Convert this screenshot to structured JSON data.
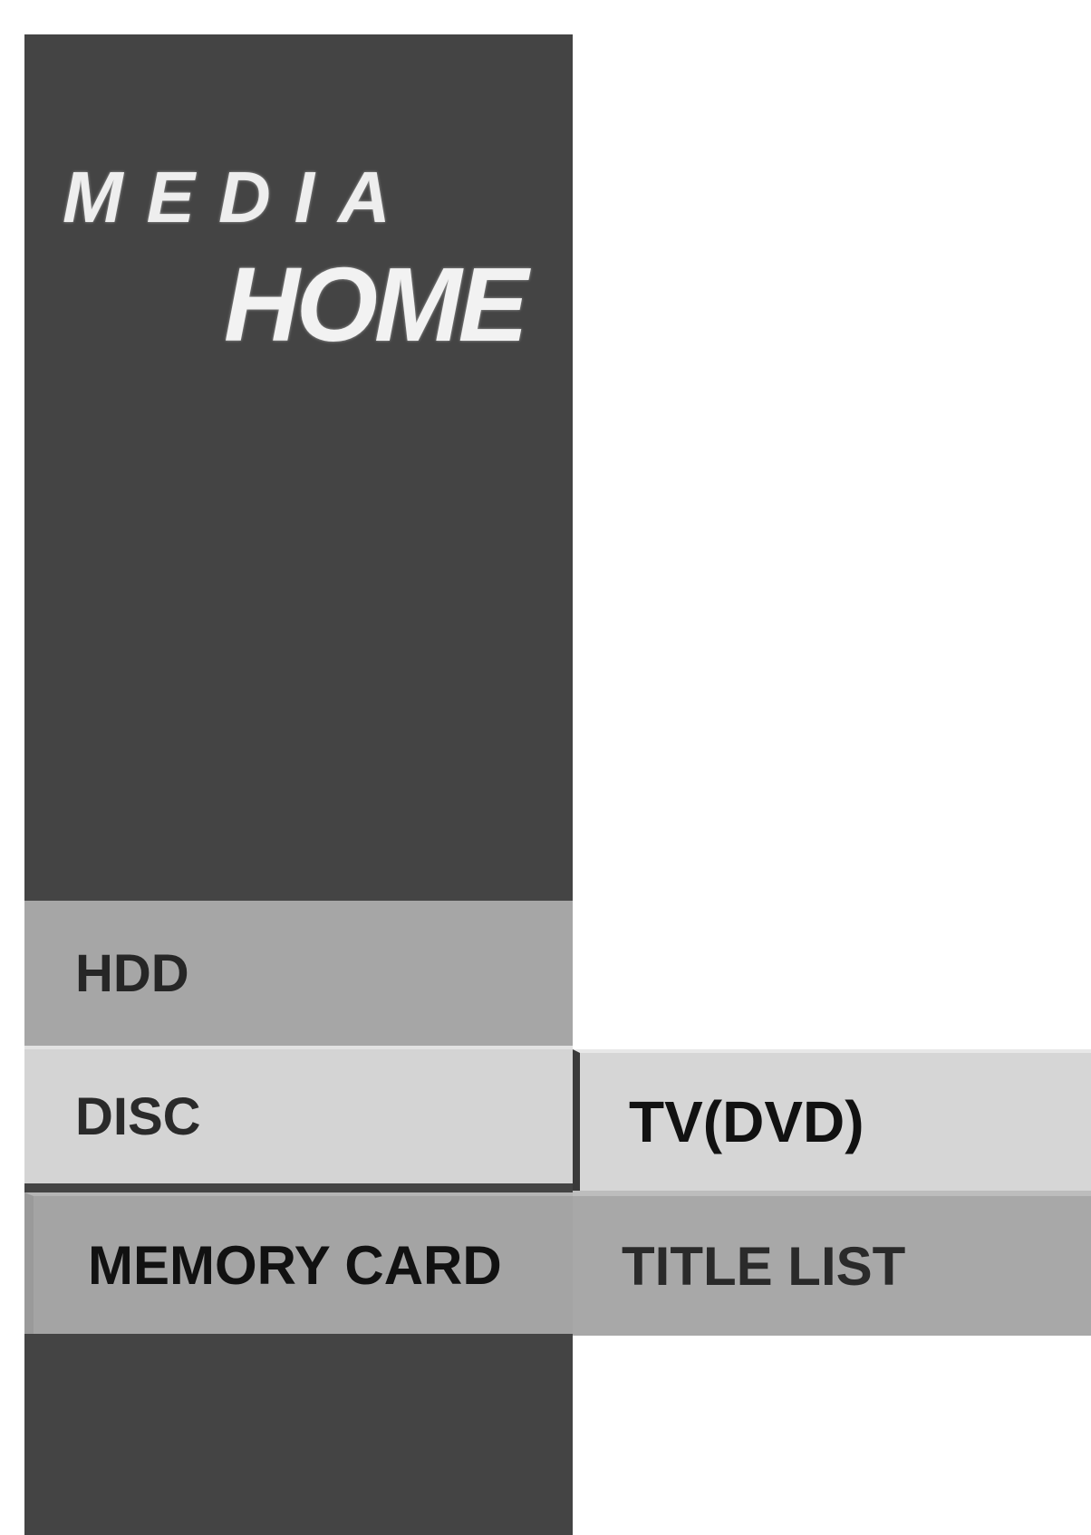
{
  "logo": {
    "line1": "MEDIA",
    "line2": "HOME"
  },
  "menu": {
    "items": [
      {
        "label": "HDD"
      },
      {
        "label": "DISC"
      },
      {
        "label": "MEMORY CARD"
      }
    ]
  },
  "submenu": {
    "items": [
      {
        "label": "TV(DVD)"
      },
      {
        "label": "TITLE LIST"
      }
    ]
  },
  "colors": {
    "sidebar": "#444444",
    "menu_item": "#a6a6a6",
    "menu_item_light": "#d4d4d4"
  }
}
